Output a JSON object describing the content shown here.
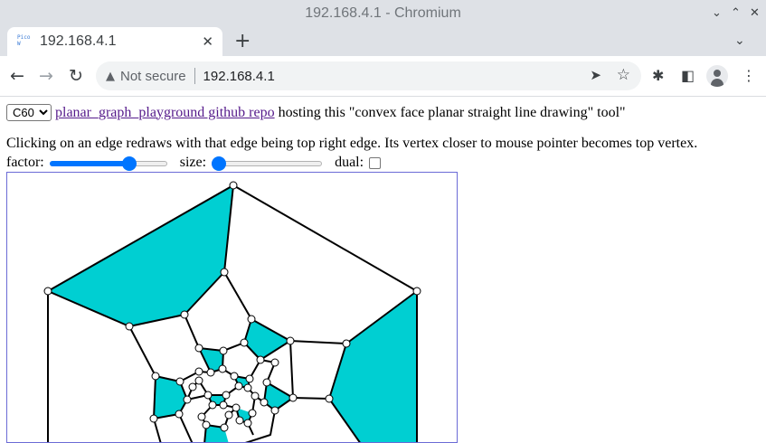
{
  "window": {
    "title": "192.168.4.1 - Chromium",
    "controls": [
      "⌄",
      "⌃",
      "✕"
    ]
  },
  "tabs": [
    {
      "title": "192.168.4.1",
      "favicon_text": "Pico W"
    }
  ],
  "toolbar": {
    "security_label": "Not secure",
    "url": "192.168.4.1"
  },
  "page": {
    "graph_select": {
      "value": "C60",
      "options": [
        "C60"
      ]
    },
    "repo_link": "planar_graph_playground github repo",
    "hosting_text": "hosting this \"convex face planar straight line drawing\" tool\"",
    "hint_text": "Clicking on an edge redraws with that edge being top right edge. Its vertex closer to mouse pointer becomes top vertex.",
    "factor_label": "factor:",
    "factor_value": 0.7,
    "size_label": "size:",
    "size_value": 0.0,
    "dual_label": "dual:",
    "dual_checked": false,
    "colors": {
      "face_fill": "#00cfd2",
      "edge": "#000000",
      "canvas_border": "#6b6bd6",
      "slider": "#0075ff"
    }
  }
}
